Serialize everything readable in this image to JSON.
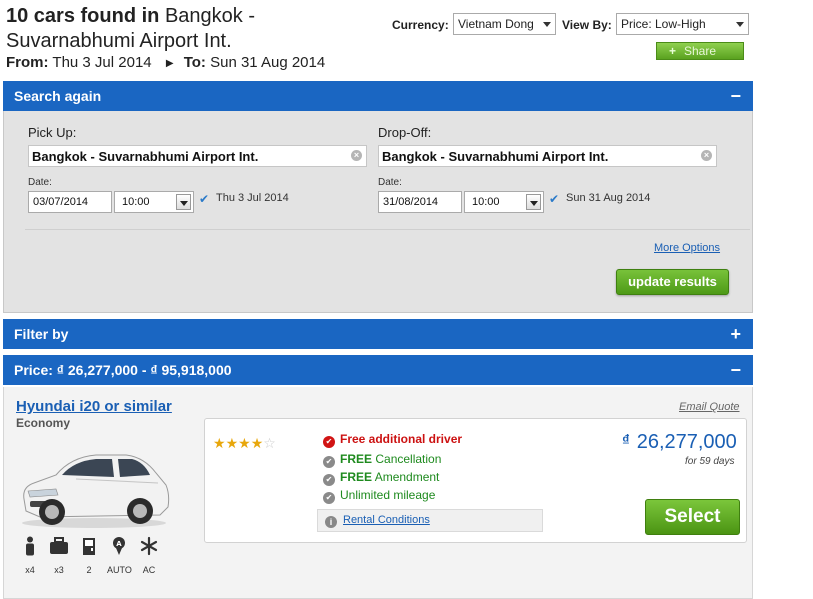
{
  "header": {
    "count_text": "10 cars found in",
    "location_line1": "Bangkok -",
    "location_line2": "Suvarnabhumi Airport Int.",
    "from_label": "From:",
    "from_date": "Thu 3 Jul 2014",
    "to_label": "To:",
    "to_date": "Sun 31 Aug 2014"
  },
  "controls": {
    "currency_label": "Currency:",
    "currency_value": "Vietnam Dong",
    "viewby_label": "View By:",
    "viewby_value": "Price: Low-High",
    "share_label": "Share"
  },
  "search": {
    "title": "Search again",
    "toggle": "−",
    "pickup_label": "Pick Up:",
    "pickup_value": "Bangkok - Suvarnabhumi Airport Int.",
    "dropoff_label": "Drop-Off:",
    "dropoff_value": "Bangkok - Suvarnabhumi Airport Int.",
    "date_label": "Date:",
    "pickup_date": "03/07/2014",
    "pickup_time": "10:00",
    "pickup_date_text": "Thu 3 Jul 2014",
    "dropoff_date": "31/08/2014",
    "dropoff_time": "10:00",
    "dropoff_date_text": "Sun 31 Aug 2014",
    "more_options": "More Options",
    "update_button": "update results"
  },
  "filter": {
    "title": "Filter by",
    "toggle": "+"
  },
  "price_filter": {
    "title": "Price: ₫ 26,277,000 - ₫ 95,918,000",
    "toggle": "−"
  },
  "result": {
    "car_name": "Hyundai i20 or similar",
    "category": "Economy",
    "email_quote": "Email Quote",
    "rating": 4,
    "rating_max": 5,
    "features": [
      {
        "bold": "",
        "text": "Free additional driver",
        "icon": "check-icon"
      },
      {
        "bold": "FREE",
        "text": " Cancellation",
        "icon": "check-icon"
      },
      {
        "bold": "FREE",
        "text": " Amendment",
        "icon": "check-icon"
      },
      {
        "bold": "",
        "text": "Unlimited mileage",
        "icon": "check-icon"
      }
    ],
    "rental_conditions": "Rental Conditions",
    "currency_symbol": "₫",
    "price": "26,277,000",
    "duration": "for 59 days",
    "select_button": "Select",
    "specs": [
      {
        "icon": "passenger-icon",
        "value": "x4"
      },
      {
        "icon": "luggage-icon",
        "value": "x3"
      },
      {
        "icon": "door-icon",
        "value": "2"
      },
      {
        "icon": "transmission-icon",
        "value": "AUTO"
      },
      {
        "icon": "aircon-icon",
        "value": "AC"
      }
    ]
  }
}
